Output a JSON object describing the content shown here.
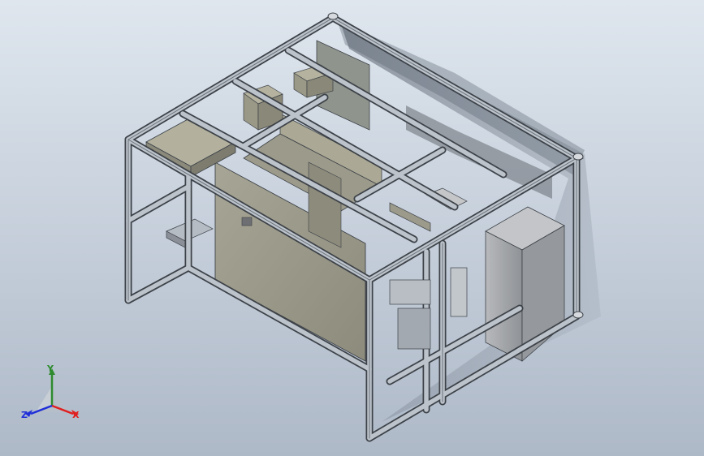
{
  "viewport": {
    "background_top": "#dfe6ee",
    "background_bottom": "#aeb9c8"
  },
  "model": {
    "frame_color": "#bcc3cb",
    "frame_edge": "#3d4248",
    "panel_color": "#9c9a8a",
    "cabinet_color": "#a6a8ab"
  },
  "triad": {
    "x_label": "X",
    "y_label": "Y",
    "z_label": "Z",
    "x_color": "#e02020",
    "y_color": "#2e8b2e",
    "z_color": "#1f2fd8"
  }
}
